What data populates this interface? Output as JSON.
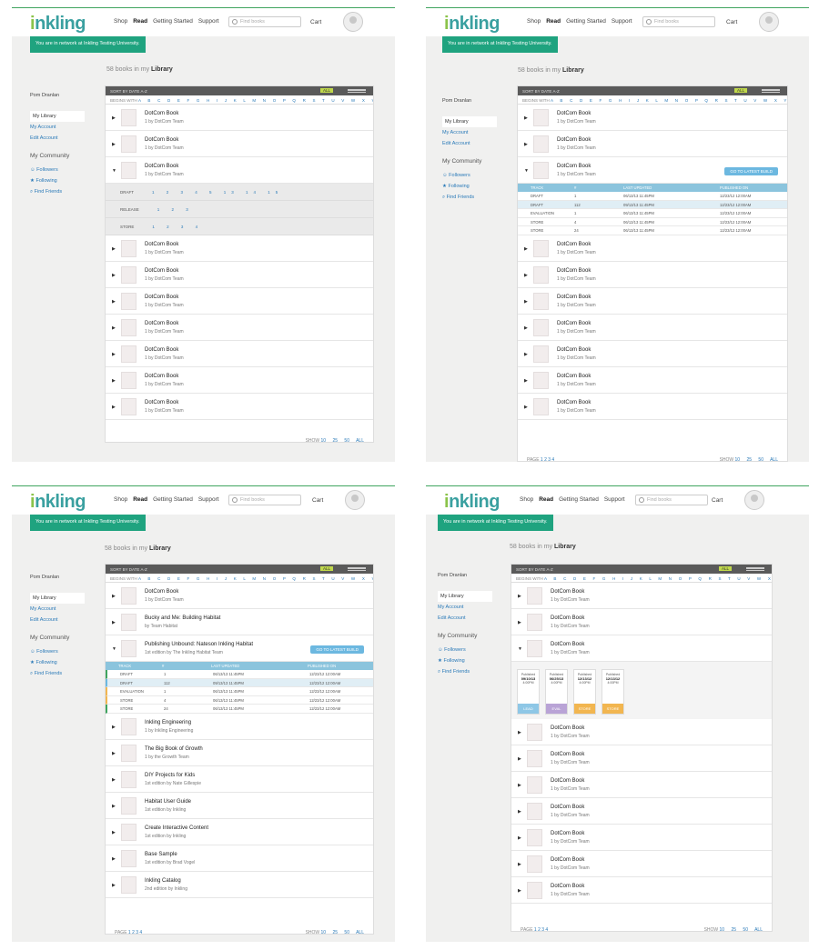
{
  "logo_prefix": "i",
  "logo_rest": "nkling",
  "nav": [
    "Shop",
    "Read",
    "Getting Started",
    "Support"
  ],
  "search_placeholder": "Find books",
  "cart": "Cart",
  "banner": "You are in network at Inkling Testing University.",
  "library_count": "58 books in my",
  "library_word": "Library",
  "sidebar": {
    "user": "Pom Dranlan",
    "items": [
      "My Library",
      "My Account",
      "Edit Account"
    ],
    "community_heading": "My Community",
    "community": [
      "Followers",
      "Following",
      "Find Friends"
    ]
  },
  "toolbar": {
    "sort_label": "SORT BY",
    "date": "DATE",
    "az": "A-Z",
    "filter": "FILTER",
    "fav": "ALL"
  },
  "alpha_label": "BEGINS WITH",
  "alphabet": "A B C D E F G H I J K L M N O P Q R S T U V W X Y Z ALL",
  "book": {
    "title": "DotCom Book",
    "sub": "1 by DotCom Team"
  },
  "sub_rows": [
    {
      "label": "DRAFT",
      "nums": "1 2 3 4 5 13 14 15"
    },
    {
      "label": "RELEASE",
      "nums": "1 2 3"
    },
    {
      "label": "STORE",
      "nums": "1 2 3 4"
    }
  ],
  "table_head": [
    "TRACK",
    "#",
    "LAST UPDATED",
    "PUBLISHED ON"
  ],
  "table_rows": [
    [
      "DRAFT",
      "1",
      "06/13/13 11:45PM",
      "12/23/12 12:00AM"
    ],
    [
      "DRAFT",
      "112",
      "09/13/13 11:45PM",
      "12/23/12 12:00AM"
    ],
    [
      "EVALUATION",
      "1",
      "06/13/13 11:45PM",
      "12/23/12 12:00AM"
    ],
    [
      "STORE",
      "4",
      "06/13/13 11:45PM",
      "12/23/12 12:00AM"
    ],
    [
      "STORE",
      "24",
      "06/13/13 11:45PM",
      "12/23/12 12:00AM"
    ]
  ],
  "goto_btn": "GO TO LATEST BUILD",
  "books_c": [
    {
      "title": "DotCom Book",
      "sub": "1 by DotCom Team"
    },
    {
      "title": "Bucky and Me: Building Habitat",
      "sub": "by Team Habitat"
    },
    {
      "title": "Publishing Unbound: Nateson Inkling Habitat",
      "sub": "1st edition by The Inkling Habitat Team"
    },
    {
      "title": "Inkling Engineering",
      "sub": "1 by Inkling Engineering"
    },
    {
      "title": "The Big Book of Growth",
      "sub": "1 by the Growth Team"
    },
    {
      "title": "DIY Projects for Kids",
      "sub": "1st edition by Nate Gillespie"
    },
    {
      "title": "Habitat User Guide",
      "sub": "1st edition by Inkling"
    },
    {
      "title": "Create Interactive Content",
      "sub": "1st edition by Inkling"
    },
    {
      "title": "Base Sample",
      "sub": "1st edition by Brad Vogel"
    },
    {
      "title": "Inkling Catalog",
      "sub": "2nd edition by Inkling"
    }
  ],
  "tiles": [
    {
      "top": "Published",
      "date": "09/10/13",
      "time": "4:00PM",
      "label": "LEAD",
      "color": "#8ec7e6"
    },
    {
      "top": "Published",
      "date": "06/25/13",
      "time": "4:00PM",
      "label": "EVAL",
      "color": "#b9a3d6"
    },
    {
      "top": "Published",
      "date": "12/13/12",
      "time": "4:00PM",
      "label": "STORE",
      "color": "#f2b650"
    },
    {
      "top": "Published",
      "date": "12/13/12",
      "time": "4:00PM",
      "label": "STORE",
      "color": "#f2b650"
    }
  ],
  "pager": {
    "page": "PAGE",
    "pages": "1 2 3 4",
    "show": "SHOW",
    "sizes": "10 25 50 ALL"
  }
}
